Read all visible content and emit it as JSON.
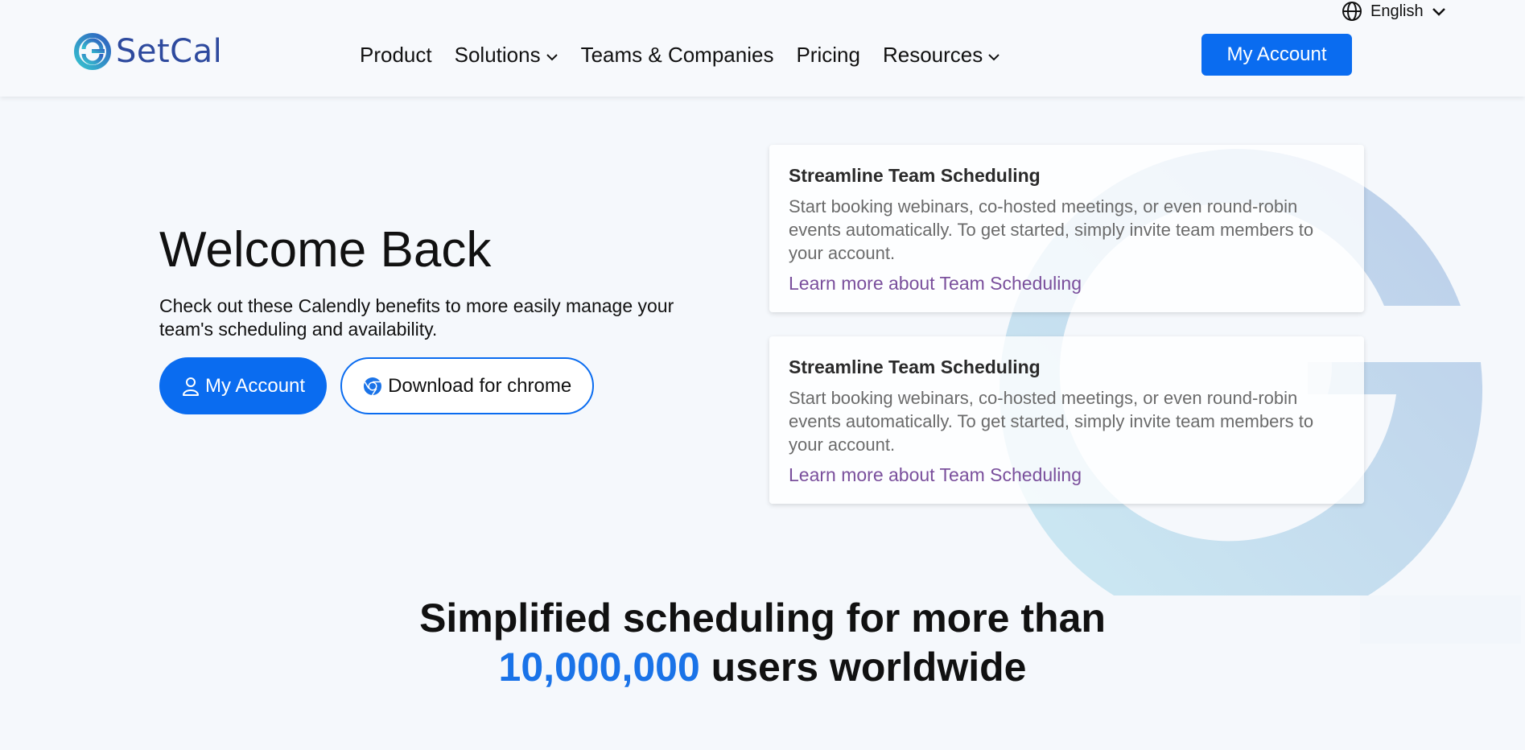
{
  "header": {
    "logo_text": "SetCal",
    "language": "English",
    "nav": [
      {
        "label": "Product",
        "has_dropdown": false
      },
      {
        "label": "Solutions",
        "has_dropdown": true
      },
      {
        "label": "Teams & Companies",
        "has_dropdown": false
      },
      {
        "label": "Pricing",
        "has_dropdown": false
      },
      {
        "label": "Resources",
        "has_dropdown": true
      }
    ],
    "account_button": "My Account"
  },
  "hero": {
    "title": "Welcome Back",
    "description": "Check out these Calendly benefits to more easily manage your team's scheduling and availability.",
    "primary_button": "My Account",
    "secondary_button": "Download for chrome"
  },
  "cards": [
    {
      "title": "Streamline Team Scheduling",
      "body": "Start booking webinars, co-hosted meetings, or even round-robin events automatically. To get started, simply invite team members to your account.",
      "link": "Learn more about Team Scheduling"
    },
    {
      "title": "Streamline Team Scheduling",
      "body": "Start booking webinars, co-hosted meetings, or even round-robin events automatically. To get started, simply invite team members to your account.",
      "link": "Learn more about Team Scheduling"
    }
  ],
  "stats": {
    "line1": "Simplified scheduling for more than",
    "number": "10,000,000",
    "line2_suffix": " users worldwide"
  },
  "colors": {
    "accent": "#0a6cf0",
    "link": "#7a4f9c",
    "stat_number": "#1a73e8",
    "logo": "#2e4a9e"
  },
  "icons": {
    "logo": "setcal-logo-icon",
    "language": "globe-icon",
    "dropdown": "chevron-down-icon",
    "account": "user-icon",
    "download": "chrome-icon"
  }
}
